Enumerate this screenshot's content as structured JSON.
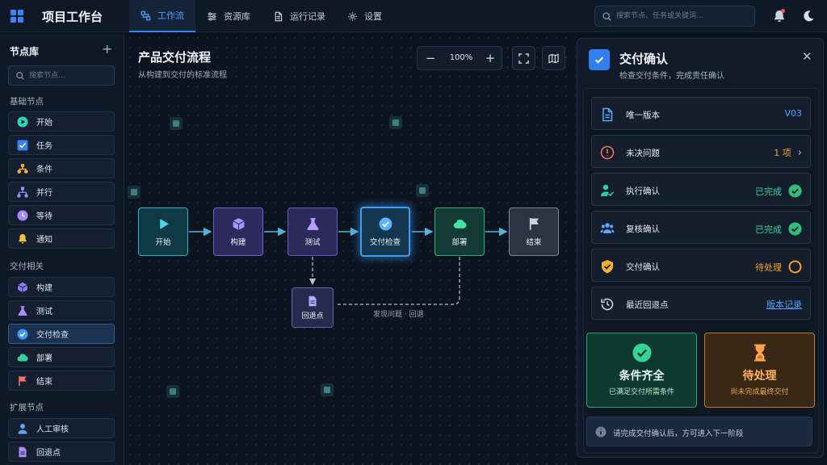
{
  "app": {
    "title": "项目工作台"
  },
  "nav": {
    "tabs": [
      {
        "label": "工作流",
        "icon": "workflow-icon",
        "active": true
      },
      {
        "label": "资源库",
        "icon": "sliders-icon"
      },
      {
        "label": "运行记录",
        "icon": "document-icon"
      },
      {
        "label": "设置",
        "icon": "gear-icon"
      }
    ],
    "search_placeholder": "搜索节点、任务或关键词..."
  },
  "sidebar": {
    "title": "节点库",
    "search_placeholder": "搜索节点...",
    "groups": [
      {
        "label": "基础节点",
        "items": [
          {
            "label": "开始",
            "icon": "play-icon",
            "color": "#2dd4bf"
          },
          {
            "label": "任务",
            "icon": "checkbox-icon",
            "color": "#3b82f6"
          },
          {
            "label": "条件",
            "icon": "branch-icon",
            "color": "#f5b13d"
          },
          {
            "label": "并行",
            "icon": "parallel-icon",
            "color": "#8b9cff"
          },
          {
            "label": "等待",
            "icon": "clock-icon",
            "color": "#a78bfa"
          },
          {
            "label": "通知",
            "icon": "bell-icon",
            "color": "#f5c23d"
          }
        ]
      },
      {
        "label": "交付相关",
        "items": [
          {
            "label": "构建",
            "icon": "cube-icon",
            "color": "#8b7cf6"
          },
          {
            "label": "测试",
            "icon": "flask-icon",
            "color": "#a78bfa"
          },
          {
            "label": "交付检查",
            "icon": "check-circle-icon",
            "color": "#3b9cf5",
            "active": true
          },
          {
            "label": "部署",
            "icon": "cloud-icon",
            "color": "#34d399"
          },
          {
            "label": "结束",
            "icon": "flag-icon",
            "color": "#f87171"
          }
        ]
      },
      {
        "label": "扩展节点",
        "items": [
          {
            "label": "人工审核",
            "icon": "user-icon",
            "color": "#60a5fa"
          },
          {
            "label": "回退点",
            "icon": "file-icon",
            "color": "#a78bfa"
          }
        ]
      }
    ]
  },
  "canvas": {
    "title": "产品交付流程",
    "subtitle": "从构建到交付的标准流程",
    "zoom": "100%",
    "nodes": [
      {
        "label": "开始",
        "icon": "play-icon"
      },
      {
        "label": "构建",
        "icon": "cube-icon"
      },
      {
        "label": "测试",
        "icon": "flask-icon"
      },
      {
        "label": "交付检查",
        "icon": "check-circle-icon",
        "selected": true
      },
      {
        "label": "部署",
        "icon": "cloud-icon"
      },
      {
        "label": "结束",
        "icon": "flag-icon"
      }
    ],
    "rollback_node": {
      "label": "回退点",
      "icon": "file-icon"
    },
    "rollback_edge_label": "发现问题 · 回退"
  },
  "panel": {
    "title": "交付确认",
    "subtitle": "检查交付条件，完成责任确认",
    "rows": [
      {
        "label": "唯一版本",
        "value": "V03",
        "icon": "document-icon",
        "value_color": "#4ea3ff"
      },
      {
        "label": "未决问题",
        "value": "1 项",
        "icon": "alert-circle-icon",
        "value_color": "#f59e3d"
      },
      {
        "label": "执行确认",
        "value": "已完成",
        "icon": "user-check-icon",
        "value_color": "#34d399"
      },
      {
        "label": "复核确认",
        "value": "已完成",
        "icon": "users-icon",
        "value_color": "#34d399"
      },
      {
        "label": "交付确认",
        "value": "待处理",
        "icon": "shield-check-icon",
        "value_color": "#f5a524"
      },
      {
        "label": "最近回退点",
        "value": "版本记录",
        "icon": "history-icon",
        "value_color": "#4ea3ff"
      }
    ],
    "cards": [
      {
        "title": "条件齐全",
        "subtitle": "已满足交付所需条件",
        "icon": "check-circle-icon"
      },
      {
        "title": "待处理",
        "subtitle": "尚未完成最终交付",
        "icon": "hourglass-icon"
      }
    ],
    "info": "请完成交付确认后，方可进入下一阶段"
  }
}
